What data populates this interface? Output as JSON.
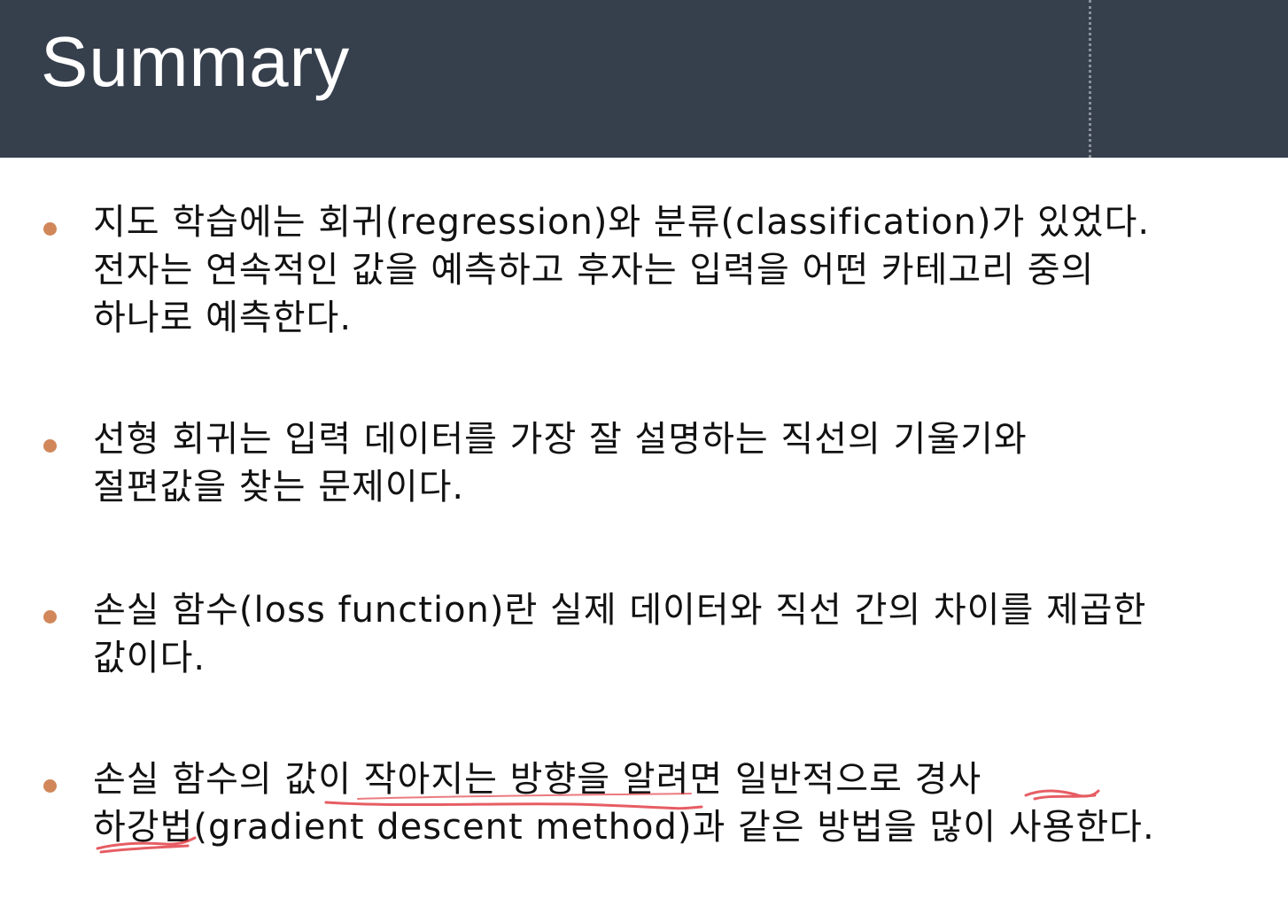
{
  "slide": {
    "title": "Summary",
    "bullets": [
      {
        "text": "지도 학습에는 회귀(regression)와 분류(classification)가 있었다.\n전자는 연속적인 값을 예측하고 후자는 입력을 어떤 카테고리 중의\n하나로 예측한다."
      },
      {
        "text": "선형 회귀는 입력 데이터를 가장 잘 설명하는 직선의 기울기와\n절편값을 찾는 문제이다."
      },
      {
        "text": "손실 함수(loss function)란 실제 데이터와 직선 간의 차이를 제곱한\n값이다."
      },
      {
        "text": "손실 함수의 값이 작아지는 방향을 알려면 일반적으로 경사\n하강법(gradient descent method)과 같은 방법을 많이 사용한다."
      }
    ]
  },
  "colors": {
    "header_bg": "#363f4c",
    "title_text": "#ffffff",
    "bullet_dot": "#d1875a",
    "body_text": "#111111",
    "annotation_ink": "#e0343c"
  }
}
